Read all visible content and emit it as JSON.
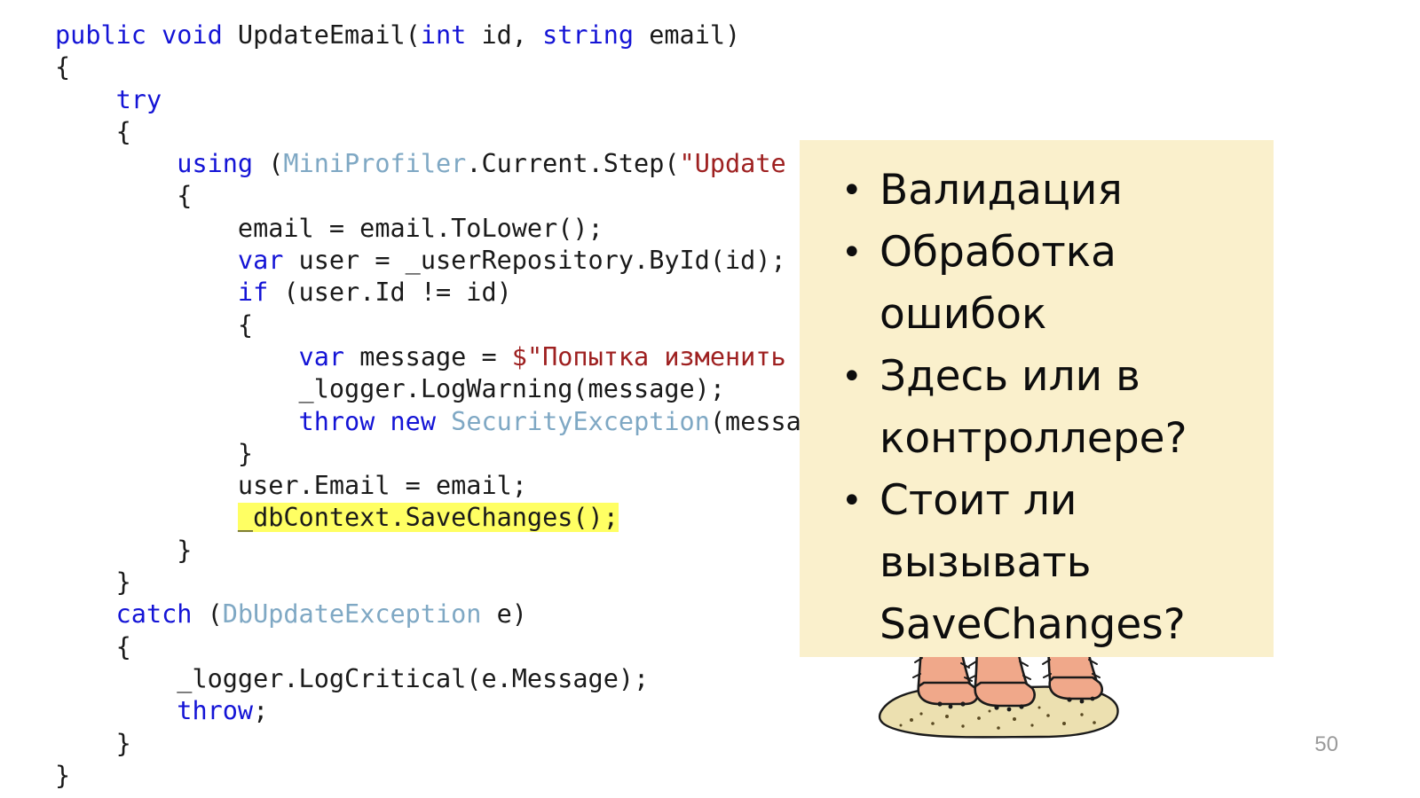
{
  "slide": {
    "number": "50",
    "background_color": "#ffffff"
  },
  "code": {
    "language": "csharp",
    "font": "monospace",
    "colors": {
      "keyword": "#1414d6",
      "type": "#7fa8c4",
      "string": "#9e2020",
      "plain": "#1a1a1a",
      "highlight_background": "#ffff63"
    },
    "lines": [
      {
        "id": 1,
        "indent": 0,
        "tokens": [
          {
            "t": "public",
            "c": "kw"
          },
          {
            "t": " ",
            "c": "plain"
          },
          {
            "t": "void",
            "c": "kw"
          },
          {
            "t": " UpdateEmail(",
            "c": "plain"
          },
          {
            "t": "int",
            "c": "kw"
          },
          {
            "t": " id, ",
            "c": "plain"
          },
          {
            "t": "string",
            "c": "kw"
          },
          {
            "t": " email)",
            "c": "plain"
          }
        ]
      },
      {
        "id": 2,
        "indent": 0,
        "tokens": [
          {
            "t": "{",
            "c": "plain"
          }
        ]
      },
      {
        "id": 3,
        "indent": 1,
        "tokens": [
          {
            "t": "try",
            "c": "kw"
          }
        ]
      },
      {
        "id": 4,
        "indent": 1,
        "tokens": [
          {
            "t": "{",
            "c": "plain"
          }
        ]
      },
      {
        "id": 5,
        "indent": 2,
        "tokens": [
          {
            "t": "using",
            "c": "kw"
          },
          {
            "t": " (",
            "c": "plain"
          },
          {
            "t": "MiniProfiler",
            "c": "type"
          },
          {
            "t": ".Current.Step(",
            "c": "plain"
          },
          {
            "t": "\"Update email\"",
            "c": "str"
          },
          {
            "t": "))",
            "c": "plain"
          }
        ]
      },
      {
        "id": 6,
        "indent": 2,
        "tokens": [
          {
            "t": "{",
            "c": "plain"
          }
        ]
      },
      {
        "id": 7,
        "indent": 3,
        "tokens": [
          {
            "t": "email = email.ToLower();",
            "c": "plain"
          }
        ]
      },
      {
        "id": 8,
        "indent": 3,
        "tokens": [
          {
            "t": "var",
            "c": "kw"
          },
          {
            "t": " user = _userRepository.ById(id);",
            "c": "plain"
          }
        ]
      },
      {
        "id": 9,
        "indent": 3,
        "tokens": [
          {
            "t": "if",
            "c": "kw"
          },
          {
            "t": " (user.Id != id)",
            "c": "plain"
          }
        ]
      },
      {
        "id": 10,
        "indent": 3,
        "tokens": [
          {
            "t": "{",
            "c": "plain"
          }
        ]
      },
      {
        "id": 11,
        "indent": 4,
        "tokens": [
          {
            "t": "var",
            "c": "kw"
          },
          {
            "t": " message = ",
            "c": "plain"
          },
          {
            "t": "$\"Попытка изменить чужой email\"",
            "c": "str"
          },
          {
            "t": ";",
            "c": "plain"
          }
        ]
      },
      {
        "id": 12,
        "indent": 4,
        "tokens": [
          {
            "t": "_logger.LogWarning(message);",
            "c": "plain"
          }
        ]
      },
      {
        "id": 13,
        "indent": 4,
        "tokens": [
          {
            "t": "throw",
            "c": "kw"
          },
          {
            "t": " ",
            "c": "plain"
          },
          {
            "t": "new",
            "c": "kw"
          },
          {
            "t": " ",
            "c": "plain"
          },
          {
            "t": "SecurityException",
            "c": "type"
          },
          {
            "t": "(message);",
            "c": "plain"
          }
        ]
      },
      {
        "id": 14,
        "indent": 3,
        "tokens": [
          {
            "t": "}",
            "c": "plain"
          }
        ]
      },
      {
        "id": 15,
        "indent": 3,
        "tokens": [
          {
            "t": "user.Email = email;",
            "c": "plain"
          }
        ]
      },
      {
        "id": 16,
        "indent": 3,
        "highlight": true,
        "tokens": [
          {
            "t": "_dbContext.SaveChanges();",
            "c": "plain"
          }
        ]
      },
      {
        "id": 17,
        "indent": 2,
        "tokens": [
          {
            "t": "}",
            "c": "plain"
          }
        ]
      },
      {
        "id": 18,
        "indent": 1,
        "tokens": [
          {
            "t": "}",
            "c": "plain"
          }
        ]
      },
      {
        "id": 19,
        "indent": 1,
        "tokens": [
          {
            "t": "catch",
            "c": "kw"
          },
          {
            "t": " (",
            "c": "plain"
          },
          {
            "t": "DbUpdateException",
            "c": "type"
          },
          {
            "t": " e)",
            "c": "plain"
          }
        ]
      },
      {
        "id": 20,
        "indent": 1,
        "tokens": [
          {
            "t": "{",
            "c": "plain"
          }
        ]
      },
      {
        "id": 21,
        "indent": 2,
        "tokens": [
          {
            "t": "_logger.LogCritical(e.Message);",
            "c": "plain"
          }
        ]
      },
      {
        "id": 22,
        "indent": 2,
        "tokens": [
          {
            "t": "throw",
            "c": "kw"
          },
          {
            "t": ";",
            "c": "plain"
          }
        ]
      },
      {
        "id": 23,
        "indent": 1,
        "tokens": [
          {
            "t": "}",
            "c": "plain"
          }
        ]
      },
      {
        "id": 24,
        "indent": 0,
        "tokens": [
          {
            "t": "}",
            "c": "plain"
          }
        ]
      }
    ]
  },
  "callout": {
    "background_color": "#faf0cc",
    "bullet_glyph": "•",
    "items": [
      {
        "text": "Валидация"
      },
      {
        "text": "Обработка ошибок"
      },
      {
        "text": "Здесь или в контроллере?"
      },
      {
        "text": "Стоит ли вызывать SaveChanges?"
      }
    ]
  },
  "clipart": {
    "name": "legs-standing-in-sand",
    "colors": {
      "skin": "#f0a88a",
      "skin_shadow": "#e08f70",
      "sand": "#ece0b0",
      "sand_shadow": "#d8c88c",
      "outline": "#1a1a1a"
    }
  }
}
